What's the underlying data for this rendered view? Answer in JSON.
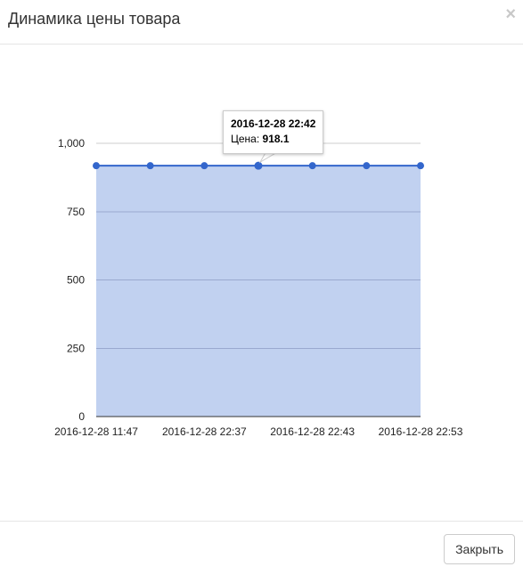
{
  "modal": {
    "title": "Динамика цены товара",
    "close_icon": "close-icon",
    "close_glyph": "×",
    "footer_button_label": "Закрыть"
  },
  "tooltip": {
    "date": "2016-12-28 22:42",
    "value_label": "Цена:",
    "value": "918.1"
  },
  "colors": {
    "line": "#3366cc",
    "area": "#c1d1f0",
    "grid": "#cccccc"
  },
  "chart_data": {
    "type": "area",
    "title": "",
    "xlabel": "",
    "ylabel": "",
    "ylim": [
      0,
      1000
    ],
    "yticks": [
      0,
      250,
      500,
      750,
      1000
    ],
    "ytick_labels": [
      "0",
      "250",
      "500",
      "750",
      "1,000"
    ],
    "x_tick_labels": [
      "2016-12-28 11:47",
      "2016-12-28 22:37",
      "2016-12-28 22:43",
      "2016-12-28 22:53"
    ],
    "series": [
      {
        "values": [
          918.1,
          918.1,
          918.1,
          918.1,
          918.1,
          918.1,
          918.1
        ]
      }
    ],
    "highlighted_point_index": 3
  }
}
